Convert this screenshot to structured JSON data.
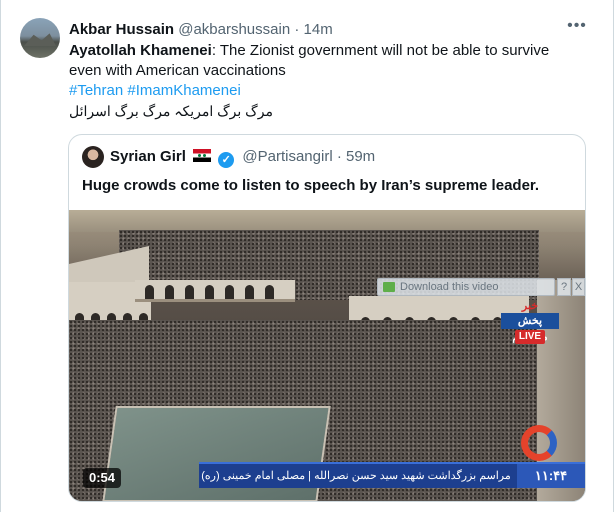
{
  "tweet": {
    "author_name": "Akbar Hussain",
    "author_handle": "@akbarshussain",
    "separator": "·",
    "time": "14m",
    "more_label": "•••",
    "text_bold": "Ayatollah Khamenei",
    "text_rest": ": The Zionist government will not be able to survive even with American vaccinations",
    "hashtags": [
      "#Tehran",
      "#ImamKhamenei"
    ],
    "urdu_line": "مرگ برگ امریکہ مرگ برگ اسرائل"
  },
  "quoted": {
    "author_name": "Syrian Girl",
    "author_handle": "@Partisangirl",
    "separator": "·",
    "time": "59m",
    "text": "Huge crowds come to listen to speech by Iran’s supreme leader.",
    "video": {
      "duration": "0:54",
      "download_label": "Download this video",
      "help_label": "?",
      "close_label": "X",
      "live_logo_top": "خبر",
      "live_logo_mid": "پخش مستقیم",
      "live_logo_badge": "LIVE",
      "ticker_text": "مراسم بزرگداشت شهید سید حسن نصرالله | مصلی امام خمینی (ره)",
      "ticker_time": "۱۱:۴۴"
    }
  },
  "colors": {
    "link": "#1d9bf0",
    "text": "#0f1419",
    "muted": "#536471",
    "border": "#cfd9de"
  }
}
